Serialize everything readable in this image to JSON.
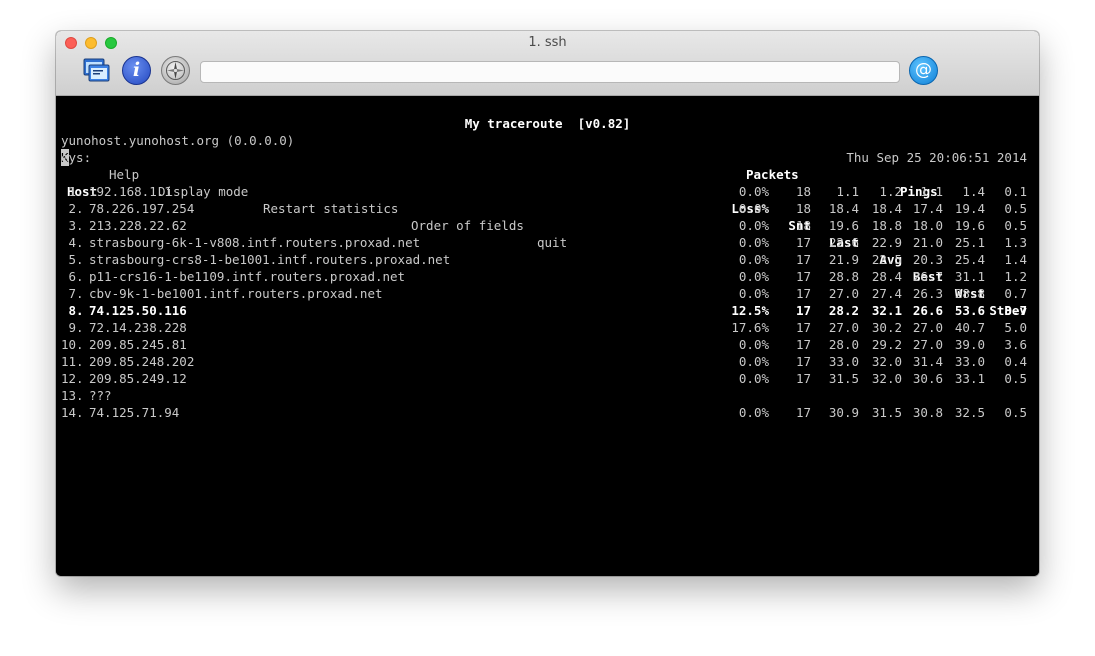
{
  "window": {
    "title": "1. ssh",
    "url_value": ""
  },
  "toolbar": {
    "icons": [
      "ssh-windows-icon",
      "info-icon",
      "compass-icon",
      "at-icon"
    ]
  },
  "app": {
    "title": "My traceroute  [v0.82]",
    "host_line": "yunohost.yunohost.org (0.0.0.0)",
    "datetime": "Thu Sep 25 20:06:51 2014",
    "keys_prefix_cursor": "K",
    "keys_prefix_rest": "eys:",
    "keys": [
      "Help",
      "Display mode",
      "Restart statistics",
      "Order of fields",
      "quit"
    ]
  },
  "table": {
    "group_packets": "Packets",
    "group_pings": "Pings",
    "headers": {
      "host": "Host",
      "loss": "Loss%",
      "snt": "Snt",
      "last": "Last",
      "avg": "Avg",
      "best": "Best",
      "wrst": "Wrst",
      "stdev": "StDev"
    },
    "rows": [
      {
        "num": " 1.",
        "host": "192.168.1.1",
        "loss": "0.0%",
        "snt": "18",
        "last": "1.1",
        "avg": "1.2",
        "best": "1.1",
        "wrst": "1.4",
        "stdev": "0.1",
        "bold": false
      },
      {
        "num": " 2.",
        "host": "78.226.197.254",
        "loss": "0.0%",
        "snt": "18",
        "last": "18.4",
        "avg": "18.4",
        "best": "17.4",
        "wrst": "19.4",
        "stdev": "0.5",
        "bold": false
      },
      {
        "num": " 3.",
        "host": "213.228.22.62",
        "loss": "0.0%",
        "snt": "18",
        "last": "19.6",
        "avg": "18.8",
        "best": "18.0",
        "wrst": "19.6",
        "stdev": "0.5",
        "bold": false
      },
      {
        "num": " 4.",
        "host": "strasbourg-6k-1-v808.intf.routers.proxad.net",
        "loss": "0.0%",
        "snt": "17",
        "last": "22.6",
        "avg": "22.9",
        "best": "21.0",
        "wrst": "25.1",
        "stdev": "1.3",
        "bold": false
      },
      {
        "num": " 5.",
        "host": "strasbourg-crs8-1-be1001.intf.routers.proxad.net",
        "loss": "0.0%",
        "snt": "17",
        "last": "21.9",
        "avg": "22.5",
        "best": "20.3",
        "wrst": "25.4",
        "stdev": "1.4",
        "bold": false
      },
      {
        "num": " 6.",
        "host": "p11-crs16-1-be1109.intf.routers.proxad.net",
        "loss": "0.0%",
        "snt": "17",
        "last": "28.8",
        "avg": "28.4",
        "best": "26.7",
        "wrst": "31.1",
        "stdev": "1.2",
        "bold": false
      },
      {
        "num": " 7.",
        "host": "cbv-9k-1-be1001.intf.routers.proxad.net",
        "loss": "0.0%",
        "snt": "17",
        "last": "27.0",
        "avg": "27.4",
        "best": "26.3",
        "wrst": "28.8",
        "stdev": "0.7",
        "bold": false
      },
      {
        "num": " 8.",
        "host": "74.125.50.116",
        "loss": "12.5%",
        "snt": "17",
        "last": "28.2",
        "avg": "32.1",
        "best": "26.6",
        "wrst": "53.6",
        "stdev": "8.7",
        "bold": true
      },
      {
        "num": " 9.",
        "host": "72.14.238.228",
        "loss": "17.6%",
        "snt": "17",
        "last": "27.0",
        "avg": "30.2",
        "best": "27.0",
        "wrst": "40.7",
        "stdev": "5.0",
        "bold": false
      },
      {
        "num": "10.",
        "host": "209.85.245.81",
        "loss": "0.0%",
        "snt": "17",
        "last": "28.0",
        "avg": "29.2",
        "best": "27.0",
        "wrst": "39.0",
        "stdev": "3.6",
        "bold": false
      },
      {
        "num": "11.",
        "host": "209.85.248.202",
        "loss": "0.0%",
        "snt": "17",
        "last": "33.0",
        "avg": "32.0",
        "best": "31.4",
        "wrst": "33.0",
        "stdev": "0.4",
        "bold": false
      },
      {
        "num": "12.",
        "host": "209.85.249.12",
        "loss": "0.0%",
        "snt": "17",
        "last": "31.5",
        "avg": "32.0",
        "best": "30.6",
        "wrst": "33.1",
        "stdev": "0.5",
        "bold": false
      },
      {
        "num": "13.",
        "host": "???",
        "loss": "",
        "snt": "",
        "last": "",
        "avg": "",
        "best": "",
        "wrst": "",
        "stdev": "",
        "bold": false
      },
      {
        "num": "14.",
        "host": "74.125.71.94",
        "loss": "0.0%",
        "snt": "17",
        "last": "30.9",
        "avg": "31.5",
        "best": "30.8",
        "wrst": "32.5",
        "stdev": "0.5",
        "bold": false
      }
    ]
  }
}
